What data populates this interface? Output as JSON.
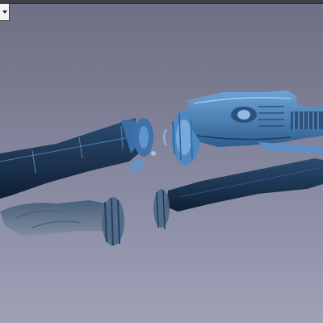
{
  "app": {
    "title": ""
  },
  "viewport": {
    "background_top": "#6d6f85",
    "background_bottom": "#9fa1b7",
    "scan_color": "#5b8fc6",
    "scan_shadow_color": "#1e3550",
    "object": "point-cloud-car-scan"
  },
  "toolbar": {
    "menu_icon": "chevron-down-icon"
  }
}
